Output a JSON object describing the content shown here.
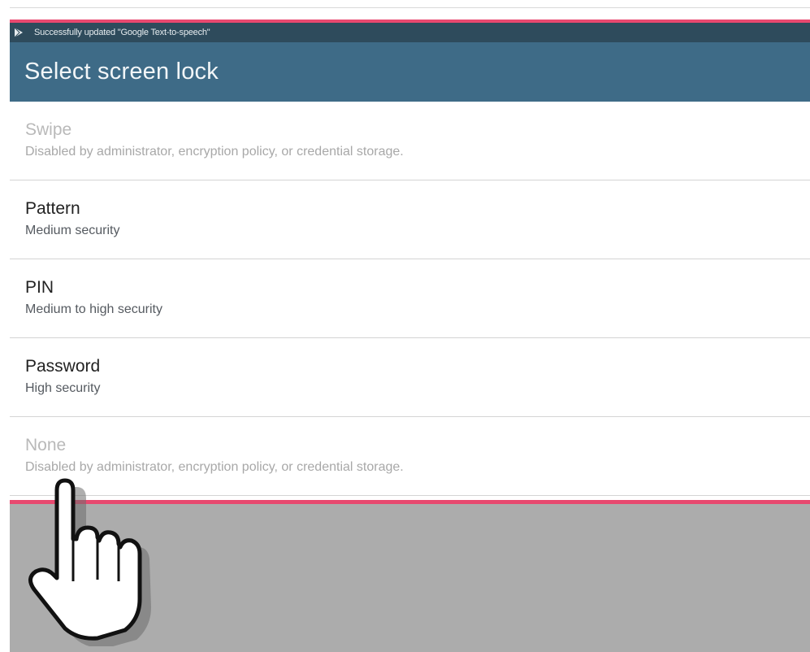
{
  "status_bar": {
    "notification_icon": "play-store-icon",
    "notification_text": "Successfully updated \"Google Text-to-speech\""
  },
  "action_bar": {
    "title": "Select screen lock"
  },
  "options": [
    {
      "title": "Swipe",
      "summary": "Disabled by administrator, encryption policy, or credential storage.",
      "enabled": false
    },
    {
      "title": "Pattern",
      "summary": "Medium security",
      "enabled": true
    },
    {
      "title": "PIN",
      "summary": "Medium to high security",
      "enabled": true
    },
    {
      "title": "Password",
      "summary": "High security",
      "enabled": true
    },
    {
      "title": "None",
      "summary": "Disabled by administrator, encryption policy, or credential storage.",
      "enabled": false
    }
  ],
  "colors": {
    "accent": "#e8496f",
    "status_bar": "#2e4b5c",
    "action_bar": "#3e6b87",
    "overlay": "#acacac"
  },
  "cursor": "hand-pointer-icon"
}
